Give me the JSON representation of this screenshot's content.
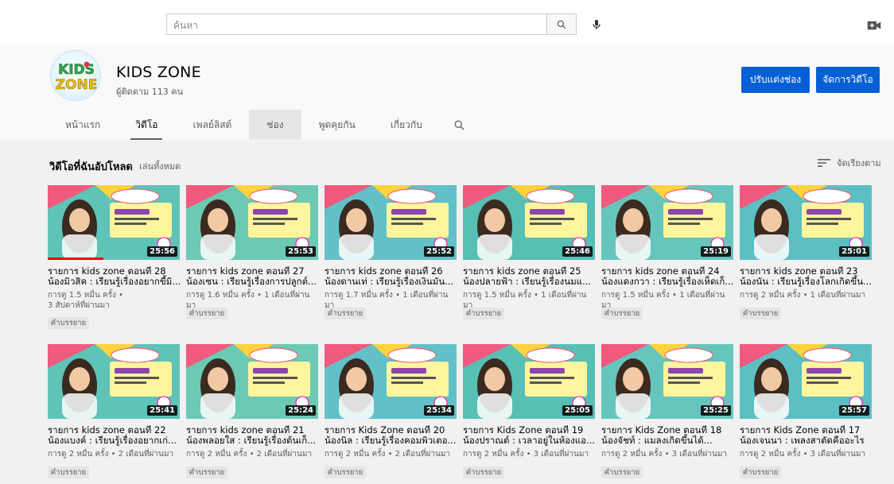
{
  "search": {
    "placeholder": "ค้นหา"
  },
  "channel": {
    "name": "KIDS ZONE",
    "subscribers": "ผู้ติดตาม 113 คน",
    "avatar_text": "KIDS ZONE",
    "customize_label": "ปรับแต่งช่อง",
    "manage_label": "จัดการวิดีโอ"
  },
  "tabs": [
    {
      "label": "หน้าแรก"
    },
    {
      "label": "วิดีโอ"
    },
    {
      "label": "เพลย์ลิสต์"
    },
    {
      "label": "ช่อง"
    },
    {
      "label": "พูดคุยกัน"
    },
    {
      "label": "เกี่ยวกับ"
    }
  ],
  "section": {
    "title": "วิดีโอที่ฉันอัปโหลด",
    "play_all": "เล่นทั้งหมด",
    "sort_label": "จัดเรียงตาม"
  },
  "colors": {
    "accent": "#065fd4",
    "progress": "#ff0000"
  },
  "videos": [
    {
      "title": "รายการ kids zone ตอนที่ 28 น้องมิวสิค : เรียนรู้เรื่องอยากขี้มิ...",
      "meta1": "การดู 1.5 หมื่น ครั้ง •",
      "meta2": "3 สัปดาห์ที่ผ่านมา",
      "duration": "25:56",
      "badge": "คำบรรยาย",
      "watched": 0.42
    },
    {
      "title": "รายการ kids zone ตอนที่ 27 น้องเซน : เรียนรู้เรื่องการปลูกต์...",
      "meta1": "การดู 1.6 หมื่น ครั้ง • 1 เดือนที่ผ่านมา",
      "meta2": "",
      "duration": "25:53",
      "badge": "คำบรรยาย",
      "watched": 0.0
    },
    {
      "title": "รายการ kids zone ตอนที่ 26 น้องดานเท่ : เรียนรู้เรื่องเงินมัน...",
      "meta1": "การดู 1.7 หมื่น ครั้ง • 1 เดือนที่ผ่านมา",
      "meta2": "",
      "duration": "25:52",
      "badge": "คำบรรยาย",
      "watched": 0.0
    },
    {
      "title": "รายการ kids zone ตอนที่ 25 น้องปลายฟ้า : เรียนรู้เรื่องนมแ...",
      "meta1": "การดู 1.5 หมื่น ครั้ง • 1 เดือนที่ผ่านมา",
      "meta2": "",
      "duration": "25:46",
      "badge": "คำบรรยาย",
      "watched": 0.0
    },
    {
      "title": "รายการ kids zone ตอนที่ 24 น้องแดงกวา : เรียนรู้เรื่องเห็ดเก็...",
      "meta1": "การดู 1.5 หมื่น ครั้ง • 1 เดือนที่ผ่านมา",
      "meta2": "",
      "duration": "25:19",
      "badge": "คำบรรยาย",
      "watched": 0.0
    },
    {
      "title": "รายการ kids zone ตอนที่ 23 น้องนัน : เรียนรู้เรื่องโลกเกิดขึ้น...",
      "meta1": "การดู 2 หมื่น ครั้ง • 1 เดือนที่ผ่านมา",
      "meta2": "",
      "duration": "25:01",
      "badge": "คำบรรยาย",
      "watched": 0.0
    },
    {
      "title": "รายการ kids zone ตอนที่ 22 น้องแบงค์ : เรียนรู้เรื่องอยากเก่...",
      "meta1": "การดู 2 หมื่น ครั้ง • 2 เดือนที่ผ่านมา",
      "meta2": "",
      "duration": "25:41",
      "badge": "คำบรรยาย",
      "watched": 0.0
    },
    {
      "title": "รายการ kids zone ตอนที่ 21 น้องพลอยใส : เรียนรู้เรื่องต้นเก็...",
      "meta1": "การดู 2 หมื่น ครั้ง • 2 เดือนที่ผ่านมา",
      "meta2": "",
      "duration": "25:24",
      "badge": "คำบรรยาย",
      "watched": 0.0
    },
    {
      "title": "รายการ Kids Zone ตอนที่ 20 น้องนิล : เรียนรู้เรื่องคอมพิวเตอ...",
      "meta1": "การดู 2 หมื่น ครั้ง • 2 เดือนที่ผ่านมา",
      "meta2": "",
      "duration": "25:34",
      "badge": "คำบรรยาย",
      "watched": 0.0
    },
    {
      "title": "รายการ Kids Zone ตอนที่ 19 น้องปราณต์ : เวลาอยู่ในห้องแอ...",
      "meta1": "การดู 2 หมื่น ครั้ง • 3 เดือนที่ผ่านมา",
      "meta2": "",
      "duration": "25:05",
      "badge": "คำบรรยาย",
      "watched": 0.0
    },
    {
      "title": "รายการ Kids Zone ตอนที่ 18 น้องจัชท์ : แมลงเกิดขึ้นได้...",
      "meta1": "การดู 2 หมื่น ครั้ง • 3 เดือนที่ผ่านมา",
      "meta2": "",
      "duration": "25:25",
      "badge": "คำบรรยาย",
      "watched": 0.0
    },
    {
      "title": "รายการ Kids Zone ตอนที่ 17 น้องเจนนา : เพลงสาตัดคืออะไร",
      "meta1": "การดู 2 หมื่น ครั้ง • 3 เดือนที่ผ่านมา",
      "meta2": "",
      "duration": "25:57",
      "badge": "คำบรรยาย",
      "watched": 0.0
    }
  ]
}
